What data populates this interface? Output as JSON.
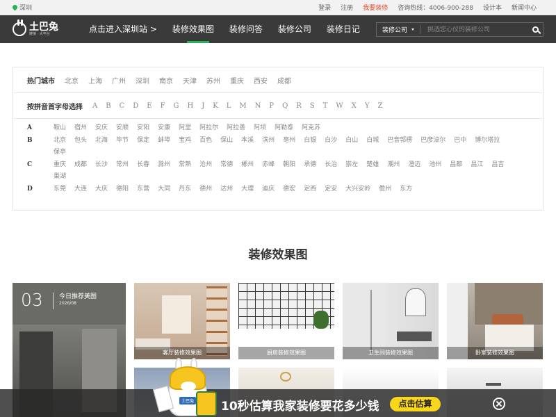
{
  "topbar": {
    "location": "深圳",
    "links": [
      {
        "label": "登录",
        "highlight": false
      },
      {
        "label": "注册",
        "highlight": false
      },
      {
        "label": "我要装修",
        "highlight": true
      },
      {
        "label": "咨询热线：4006-900-288",
        "highlight": false
      },
      {
        "label": "设计本",
        "highlight": false
      },
      {
        "label": "新闻中心",
        "highlight": false
      }
    ]
  },
  "nav": {
    "logo_name": "土巴兔",
    "logo_sub": "链接 · 大平台",
    "links": [
      "点击进入深圳站 >",
      "装修效果图",
      "装修问答",
      "装修公司",
      "装修日记"
    ],
    "active_index": 1,
    "search_select": "装修公司",
    "search_placeholder": "挑选您心仪的装修公司"
  },
  "cities": {
    "hot_label": "热门城市",
    "hot": [
      "北京",
      "上海",
      "广州",
      "深圳",
      "南京",
      "天津",
      "苏州",
      "重庆",
      "西安",
      "成都"
    ],
    "pinyin_label": "按拼音首字母选择",
    "letters": [
      "A",
      "B",
      "C",
      "D",
      "E",
      "F",
      "G",
      "H",
      "J",
      "K",
      "L",
      "M",
      "N",
      "P",
      "Q",
      "R",
      "S",
      "T",
      "W",
      "X",
      "Y",
      "Z"
    ],
    "groups": [
      {
        "letter": "A",
        "cities": [
          "鞍山",
          "宿州",
          "安庆",
          "安顺",
          "安阳",
          "安康",
          "阿里",
          "阿拉尔",
          "阿拉善",
          "阿坝",
          "阿勒泰",
          "阿克苏"
        ]
      },
      {
        "letter": "B",
        "cities": [
          "北京",
          "包头",
          "北海",
          "毕节",
          "保定",
          "蚌埠",
          "宝鸡",
          "百色",
          "保山",
          "本溪",
          "滨州",
          "亳州",
          "白银",
          "白沙",
          "白山",
          "白城",
          "巴音郭楞",
          "巴彦淖尔",
          "巴中",
          "博尔塔拉",
          "保亭"
        ]
      },
      {
        "letter": "C",
        "cities": [
          "重庆",
          "成都",
          "长沙",
          "常州",
          "长春",
          "滁州",
          "常熟",
          "沧州",
          "常德",
          "郴州",
          "赤峰",
          "朝阳",
          "承德",
          "长治",
          "崇左",
          "楚雄",
          "潮州",
          "澄迈",
          "池州",
          "昌都",
          "昌江",
          "昌吉",
          "巢湖"
        ]
      },
      {
        "letter": "D",
        "cities": [
          "东莞",
          "大连",
          "大庆",
          "德阳",
          "东营",
          "大同",
          "丹东",
          "德州",
          "达州",
          "大理",
          "迪庆",
          "德宏",
          "定西",
          "定安",
          "大兴安岭",
          "儋州",
          "东方"
        ]
      }
    ]
  },
  "section_title": "装修效果图",
  "feature": {
    "day": "03",
    "title": "今日推荐美图",
    "date": "2026/08"
  },
  "cards": [
    "客厅装修效果图",
    "厨房装修效果图",
    "卫生间装修效果图",
    "卧室装修效果图"
  ],
  "banner": {
    "mascot_label": "土巴兔",
    "text": "10秒估算我家装修要花多少钱",
    "button": "点击估算"
  }
}
